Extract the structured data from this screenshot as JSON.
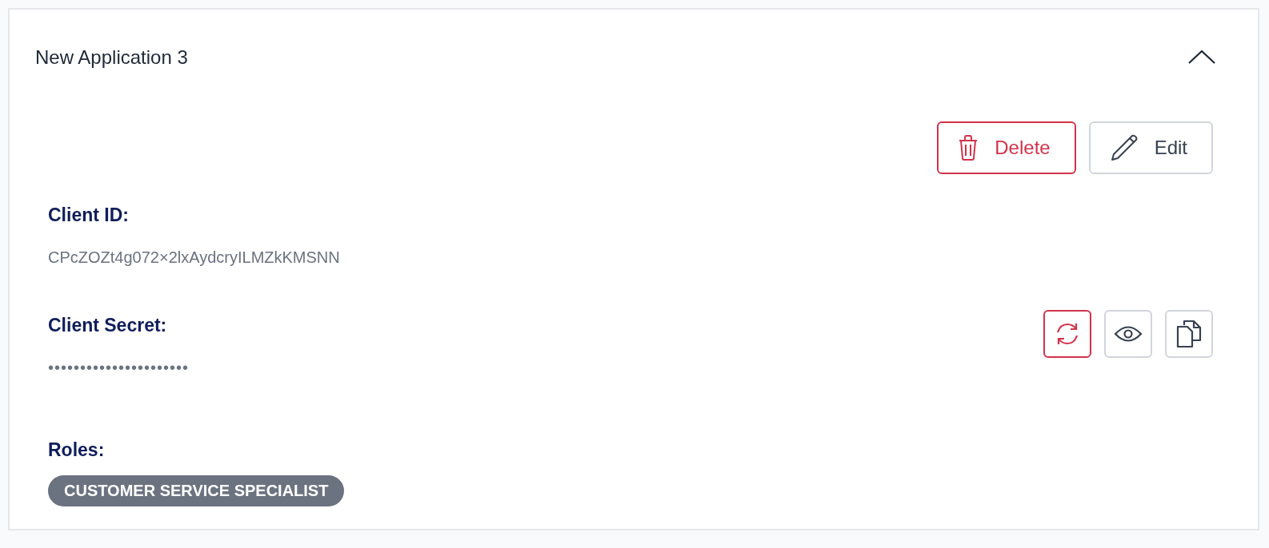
{
  "application": {
    "title": "New Application 3",
    "expanded": true,
    "actions": [
      {
        "kind": "delete",
        "label": "Delete"
      },
      {
        "kind": "edit",
        "label": "Edit"
      }
    ],
    "client_id": {
      "label": "Client ID:",
      "value": "CPcZOZt4g072×2lxAydcryILMZkKMSNN"
    },
    "client_secret": {
      "label": "Client Secret:",
      "value": "••••••••••••••••••••••",
      "actions": [
        {
          "kind": "regenerate"
        },
        {
          "kind": "reveal"
        },
        {
          "kind": "copy"
        }
      ]
    },
    "roles": {
      "label": "Roles:",
      "items": [
        "CUSTOMER SERVICE SPECIALIST"
      ]
    }
  }
}
